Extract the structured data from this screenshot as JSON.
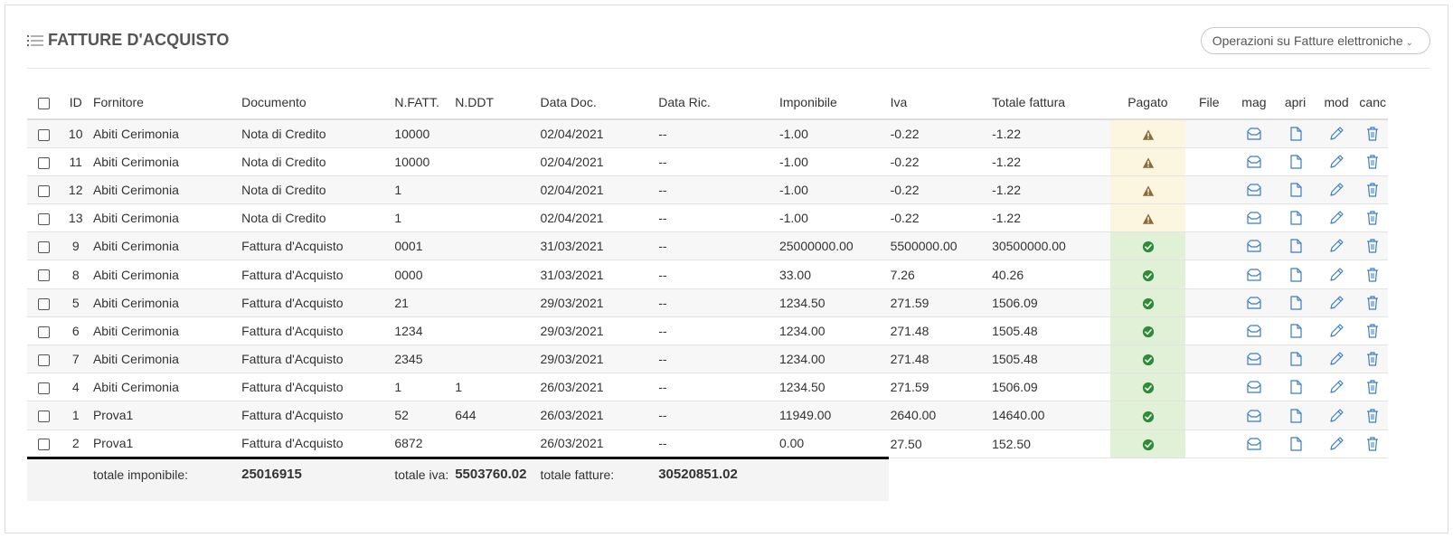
{
  "header": {
    "title": "FATTURE D'ACQUISTO",
    "ops_button": "Operazioni su Fatture elettroniche",
    "ops_chevron": "⌄"
  },
  "columns": {
    "id": "ID",
    "supplier": "Fornitore",
    "document": "Documento",
    "invoice_no": "N.FATT.",
    "ddt_no": "N.DDT",
    "doc_date": "Data Doc.",
    "received_date": "Data Ric.",
    "taxable": "Imponibile",
    "vat": "Iva",
    "total": "Totale fattura",
    "paid": "Pagato",
    "file": "File",
    "mag": "mag",
    "open": "apri",
    "edit": "mod",
    "delete": "canc"
  },
  "rows": [
    {
      "id": "10",
      "supplier": "Abiti Cerimonia",
      "document": "Nota di Credito",
      "invoice_no": "10000",
      "ddt_no": "",
      "doc_date": "02/04/2021",
      "received_date": "--",
      "taxable": "-1.00",
      "vat": "-0.22",
      "total": "-1.22",
      "paid_status": "warning"
    },
    {
      "id": "11",
      "supplier": "Abiti Cerimonia",
      "document": "Nota di Credito",
      "invoice_no": "10000",
      "ddt_no": "",
      "doc_date": "02/04/2021",
      "received_date": "--",
      "taxable": "-1.00",
      "vat": "-0.22",
      "total": "-1.22",
      "paid_status": "warning"
    },
    {
      "id": "12",
      "supplier": "Abiti Cerimonia",
      "document": "Nota di Credito",
      "invoice_no": "1",
      "ddt_no": "",
      "doc_date": "02/04/2021",
      "received_date": "--",
      "taxable": "-1.00",
      "vat": "-0.22",
      "total": "-1.22",
      "paid_status": "warning"
    },
    {
      "id": "13",
      "supplier": "Abiti Cerimonia",
      "document": "Nota di Credito",
      "invoice_no": "1",
      "ddt_no": "",
      "doc_date": "02/04/2021",
      "received_date": "--",
      "taxable": "-1.00",
      "vat": "-0.22",
      "total": "-1.22",
      "paid_status": "warning"
    },
    {
      "id": "9",
      "supplier": "Abiti Cerimonia",
      "document": "Fattura d'Acquisto",
      "invoice_no": "0001",
      "ddt_no": "",
      "doc_date": "31/03/2021",
      "received_date": "--",
      "taxable": "25000000.00",
      "vat": "5500000.00",
      "total": "30500000.00",
      "paid_status": "paid"
    },
    {
      "id": "8",
      "supplier": "Abiti Cerimonia",
      "document": "Fattura d'Acquisto",
      "invoice_no": "0000",
      "ddt_no": "",
      "doc_date": "31/03/2021",
      "received_date": "--",
      "taxable": "33.00",
      "vat": "7.26",
      "total": "40.26",
      "paid_status": "paid"
    },
    {
      "id": "5",
      "supplier": "Abiti Cerimonia",
      "document": "Fattura d'Acquisto",
      "invoice_no": "21",
      "ddt_no": "",
      "doc_date": "29/03/2021",
      "received_date": "--",
      "taxable": "1234.50",
      "vat": "271.59",
      "total": "1506.09",
      "paid_status": "paid"
    },
    {
      "id": "6",
      "supplier": "Abiti Cerimonia",
      "document": "Fattura d'Acquisto",
      "invoice_no": "1234",
      "ddt_no": "",
      "doc_date": "29/03/2021",
      "received_date": "--",
      "taxable": "1234.00",
      "vat": "271.48",
      "total": "1505.48",
      "paid_status": "paid"
    },
    {
      "id": "7",
      "supplier": "Abiti Cerimonia",
      "document": "Fattura d'Acquisto",
      "invoice_no": "2345",
      "ddt_no": "",
      "doc_date": "29/03/2021",
      "received_date": "--",
      "taxable": "1234.00",
      "vat": "271.48",
      "total": "1505.48",
      "paid_status": "paid"
    },
    {
      "id": "4",
      "supplier": "Abiti Cerimonia",
      "document": "Fattura d'Acquisto",
      "invoice_no": "1",
      "ddt_no": "1",
      "doc_date": "26/03/2021",
      "received_date": "--",
      "taxable": "1234.50",
      "vat": "271.59",
      "total": "1506.09",
      "paid_status": "paid"
    },
    {
      "id": "1",
      "supplier": "Prova1",
      "document": "Fattura d'Acquisto",
      "invoice_no": "52",
      "ddt_no": "644",
      "doc_date": "26/03/2021",
      "received_date": "--",
      "taxable": "11949.00",
      "vat": "2640.00",
      "total": "14640.00",
      "paid_status": "paid"
    },
    {
      "id": "2",
      "supplier": "Prova1",
      "document": "Fattura d'Acquisto",
      "invoice_no": "6872",
      "ddt_no": "",
      "doc_date": "26/03/2021",
      "received_date": "--",
      "taxable": "0.00",
      "vat": "27.50",
      "total": "152.50",
      "paid_status": "paid"
    }
  ],
  "totals": {
    "taxable_label": "totale imponibile:",
    "taxable_value": "25016915",
    "vat_label": "totale iva:",
    "vat_value": "5503760.02",
    "invoices_label": "totale fatture:",
    "invoices_value": "30520851.02"
  },
  "colors": {
    "warning_bg": "#fcf6e0",
    "warning_icon": "#8a6d3b",
    "paid_bg": "#e1f1d8",
    "paid_icon": "#2e8b3a",
    "action_icon": "#3b7dc4"
  },
  "icons": {
    "mag": "envelope-icon",
    "open": "file-icon",
    "edit": "pencil-icon",
    "delete": "trash-icon",
    "warning": "warning-icon",
    "paid": "check-circle-icon",
    "title": "list-icon"
  }
}
